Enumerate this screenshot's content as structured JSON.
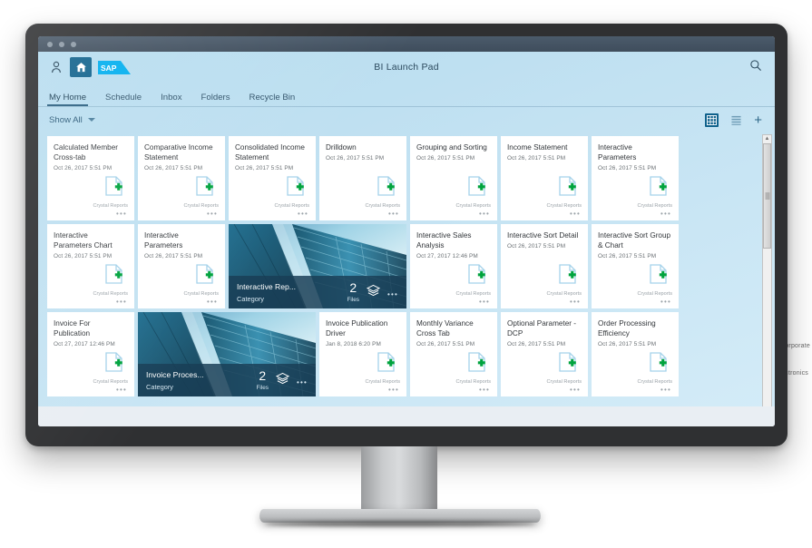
{
  "background_bleed": {
    "line1": "p Corporate",
    "line2": "ctronics"
  },
  "browser": {
    "dots": [
      "dot-red",
      "dot-yellow",
      "dot-green"
    ]
  },
  "shellbar": {
    "title": "BI Launch Pad",
    "user_icon": "person-icon",
    "home_icon": "home-icon",
    "logo": "SAP",
    "search_icon": "search-icon"
  },
  "tabs": [
    {
      "label": "My Home",
      "selected": true
    },
    {
      "label": "Schedule",
      "selected": false
    },
    {
      "label": "Inbox",
      "selected": false
    },
    {
      "label": "Folders",
      "selected": false
    },
    {
      "label": "Recycle Bin",
      "selected": false
    }
  ],
  "toolbar": {
    "filter_label": "Show All",
    "chevron_icon": "chevron-down-icon",
    "grid_view_icon": "grid-view-icon",
    "list_view_icon": "list-view-icon",
    "add_icon": "plus-icon",
    "grid_selected": true
  },
  "tiles": [
    {
      "type": "report",
      "title": "Calculated Member Cross-tab",
      "date": "Oct 26, 2017 5:51 PM",
      "kind": "Crystal Reports",
      "more": "•••"
    },
    {
      "type": "report",
      "title": "Comparative Income Statement",
      "date": "Oct 26, 2017 5:51 PM",
      "kind": "Crystal Reports",
      "more": "•••"
    },
    {
      "type": "report",
      "title": "Consolidated Income Statement",
      "date": "Oct 26, 2017 5:51 PM",
      "kind": "Crystal Reports",
      "more": "•••"
    },
    {
      "type": "report",
      "title": "Drilldown",
      "date": "Oct 26, 2017 5:51 PM",
      "kind": "Crystal Reports",
      "more": "•••"
    },
    {
      "type": "report",
      "title": "Grouping and Sorting",
      "date": "Oct 26, 2017 5:51 PM",
      "kind": "Crystal Reports",
      "more": "•••"
    },
    {
      "type": "report",
      "title": "Income Statement",
      "date": "Oct 26, 2017 5:51 PM",
      "kind": "Crystal Reports",
      "more": "•••"
    },
    {
      "type": "report",
      "title": "Interactive Parameters",
      "date": "Oct 26, 2017 5:51 PM",
      "kind": "Crystal Reports",
      "more": "•••"
    },
    {
      "type": "report",
      "title": "Interactive Parameters Chart",
      "date": "Oct 26, 2017 5:51 PM",
      "kind": "Crystal Reports",
      "more": "•••"
    },
    {
      "type": "report",
      "title": "Interactive Parameters",
      "date": "Oct 26, 2017 5:51 PM",
      "kind": "Crystal Reports",
      "more": "•••"
    },
    {
      "type": "category",
      "title": "Interactive Rep...",
      "subtitle": "Category",
      "count": "2",
      "count_label": "Files",
      "stack_icon": "layers-icon",
      "more": "•••"
    },
    {
      "type": "report",
      "title": "Interactive Sales Analysis",
      "date": "Oct 27, 2017 12:46 PM",
      "kind": "Crystal Reports",
      "more": "•••"
    },
    {
      "type": "report",
      "title": "Interactive Sort Detail",
      "date": "Oct 26, 2017 5:51 PM",
      "kind": "Crystal Reports",
      "more": "•••"
    },
    {
      "type": "report",
      "title": "Interactive Sort Group & Chart",
      "date": "Oct 26, 2017 5:51 PM",
      "kind": "Crystal Reports",
      "more": "•••"
    },
    {
      "type": "report",
      "title": "Invoice For Publication",
      "date": "Oct 27, 2017 12:46 PM",
      "kind": "Crystal Reports",
      "more": "•••"
    },
    {
      "type": "category",
      "title": "Invoice Proces...",
      "subtitle": "Category",
      "count": "2",
      "count_label": "Files",
      "stack_icon": "layers-icon",
      "more": "•••"
    },
    {
      "type": "report",
      "title": "Invoice Publication Driver",
      "date": "Jan 8, 2018 6:20 PM",
      "kind": "Crystal Reports",
      "more": "•••"
    },
    {
      "type": "report",
      "title": "Monthly Variance Cross Tab",
      "date": "Oct 26, 2017 5:51 PM",
      "kind": "Crystal Reports",
      "more": "•••"
    },
    {
      "type": "report",
      "title": "Optional Parameter - DCP",
      "date": "Oct 26, 2017 5:51 PM",
      "kind": "Crystal Reports",
      "more": "•••"
    },
    {
      "type": "report",
      "title": "Order Processing Efficiency",
      "date": "Oct 26, 2017 5:51 PM",
      "kind": "Crystal Reports",
      "more": "•••"
    }
  ],
  "scrollbar": {
    "up_arrow": "▲",
    "down_arrow": "▼"
  },
  "colors": {
    "accent": "#10628c",
    "header_blue": "#b6dcef",
    "sap_blue": "#00aeef",
    "tile_bg": "#ffffff",
    "report_green": "#00a33e",
    "category_footer": "#193e56"
  }
}
